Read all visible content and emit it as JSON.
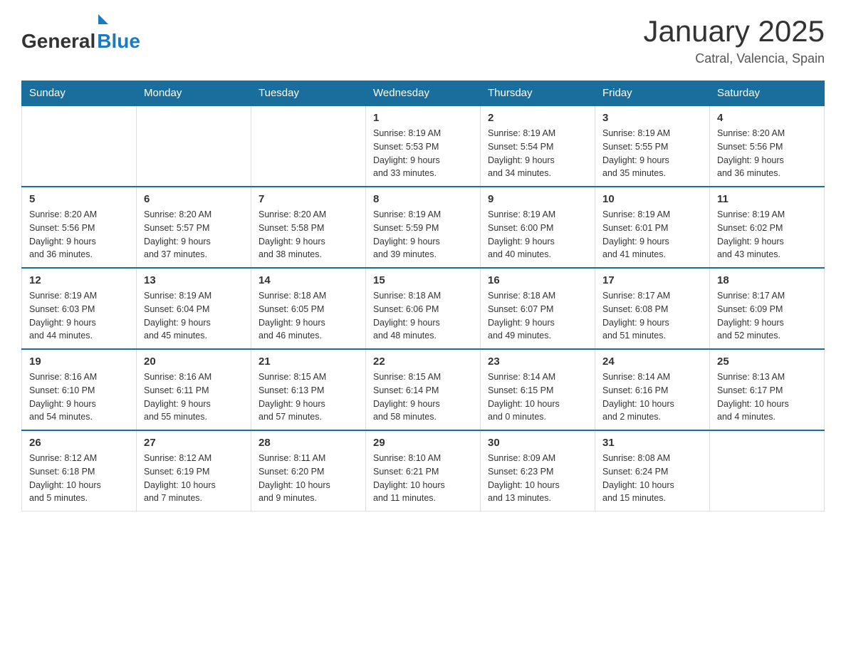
{
  "header": {
    "logo_general": "General",
    "logo_blue": "Blue",
    "title": "January 2025",
    "subtitle": "Catral, Valencia, Spain"
  },
  "weekdays": [
    "Sunday",
    "Monday",
    "Tuesday",
    "Wednesday",
    "Thursday",
    "Friday",
    "Saturday"
  ],
  "weeks": [
    [
      {
        "day": "",
        "info": ""
      },
      {
        "day": "",
        "info": ""
      },
      {
        "day": "",
        "info": ""
      },
      {
        "day": "1",
        "info": "Sunrise: 8:19 AM\nSunset: 5:53 PM\nDaylight: 9 hours\nand 33 minutes."
      },
      {
        "day": "2",
        "info": "Sunrise: 8:19 AM\nSunset: 5:54 PM\nDaylight: 9 hours\nand 34 minutes."
      },
      {
        "day": "3",
        "info": "Sunrise: 8:19 AM\nSunset: 5:55 PM\nDaylight: 9 hours\nand 35 minutes."
      },
      {
        "day": "4",
        "info": "Sunrise: 8:20 AM\nSunset: 5:56 PM\nDaylight: 9 hours\nand 36 minutes."
      }
    ],
    [
      {
        "day": "5",
        "info": "Sunrise: 8:20 AM\nSunset: 5:56 PM\nDaylight: 9 hours\nand 36 minutes."
      },
      {
        "day": "6",
        "info": "Sunrise: 8:20 AM\nSunset: 5:57 PM\nDaylight: 9 hours\nand 37 minutes."
      },
      {
        "day": "7",
        "info": "Sunrise: 8:20 AM\nSunset: 5:58 PM\nDaylight: 9 hours\nand 38 minutes."
      },
      {
        "day": "8",
        "info": "Sunrise: 8:19 AM\nSunset: 5:59 PM\nDaylight: 9 hours\nand 39 minutes."
      },
      {
        "day": "9",
        "info": "Sunrise: 8:19 AM\nSunset: 6:00 PM\nDaylight: 9 hours\nand 40 minutes."
      },
      {
        "day": "10",
        "info": "Sunrise: 8:19 AM\nSunset: 6:01 PM\nDaylight: 9 hours\nand 41 minutes."
      },
      {
        "day": "11",
        "info": "Sunrise: 8:19 AM\nSunset: 6:02 PM\nDaylight: 9 hours\nand 43 minutes."
      }
    ],
    [
      {
        "day": "12",
        "info": "Sunrise: 8:19 AM\nSunset: 6:03 PM\nDaylight: 9 hours\nand 44 minutes."
      },
      {
        "day": "13",
        "info": "Sunrise: 8:19 AM\nSunset: 6:04 PM\nDaylight: 9 hours\nand 45 minutes."
      },
      {
        "day": "14",
        "info": "Sunrise: 8:18 AM\nSunset: 6:05 PM\nDaylight: 9 hours\nand 46 minutes."
      },
      {
        "day": "15",
        "info": "Sunrise: 8:18 AM\nSunset: 6:06 PM\nDaylight: 9 hours\nand 48 minutes."
      },
      {
        "day": "16",
        "info": "Sunrise: 8:18 AM\nSunset: 6:07 PM\nDaylight: 9 hours\nand 49 minutes."
      },
      {
        "day": "17",
        "info": "Sunrise: 8:17 AM\nSunset: 6:08 PM\nDaylight: 9 hours\nand 51 minutes."
      },
      {
        "day": "18",
        "info": "Sunrise: 8:17 AM\nSunset: 6:09 PM\nDaylight: 9 hours\nand 52 minutes."
      }
    ],
    [
      {
        "day": "19",
        "info": "Sunrise: 8:16 AM\nSunset: 6:10 PM\nDaylight: 9 hours\nand 54 minutes."
      },
      {
        "day": "20",
        "info": "Sunrise: 8:16 AM\nSunset: 6:11 PM\nDaylight: 9 hours\nand 55 minutes."
      },
      {
        "day": "21",
        "info": "Sunrise: 8:15 AM\nSunset: 6:13 PM\nDaylight: 9 hours\nand 57 minutes."
      },
      {
        "day": "22",
        "info": "Sunrise: 8:15 AM\nSunset: 6:14 PM\nDaylight: 9 hours\nand 58 minutes."
      },
      {
        "day": "23",
        "info": "Sunrise: 8:14 AM\nSunset: 6:15 PM\nDaylight: 10 hours\nand 0 minutes."
      },
      {
        "day": "24",
        "info": "Sunrise: 8:14 AM\nSunset: 6:16 PM\nDaylight: 10 hours\nand 2 minutes."
      },
      {
        "day": "25",
        "info": "Sunrise: 8:13 AM\nSunset: 6:17 PM\nDaylight: 10 hours\nand 4 minutes."
      }
    ],
    [
      {
        "day": "26",
        "info": "Sunrise: 8:12 AM\nSunset: 6:18 PM\nDaylight: 10 hours\nand 5 minutes."
      },
      {
        "day": "27",
        "info": "Sunrise: 8:12 AM\nSunset: 6:19 PM\nDaylight: 10 hours\nand 7 minutes."
      },
      {
        "day": "28",
        "info": "Sunrise: 8:11 AM\nSunset: 6:20 PM\nDaylight: 10 hours\nand 9 minutes."
      },
      {
        "day": "29",
        "info": "Sunrise: 8:10 AM\nSunset: 6:21 PM\nDaylight: 10 hours\nand 11 minutes."
      },
      {
        "day": "30",
        "info": "Sunrise: 8:09 AM\nSunset: 6:23 PM\nDaylight: 10 hours\nand 13 minutes."
      },
      {
        "day": "31",
        "info": "Sunrise: 8:08 AM\nSunset: 6:24 PM\nDaylight: 10 hours\nand 15 minutes."
      },
      {
        "day": "",
        "info": ""
      }
    ]
  ]
}
